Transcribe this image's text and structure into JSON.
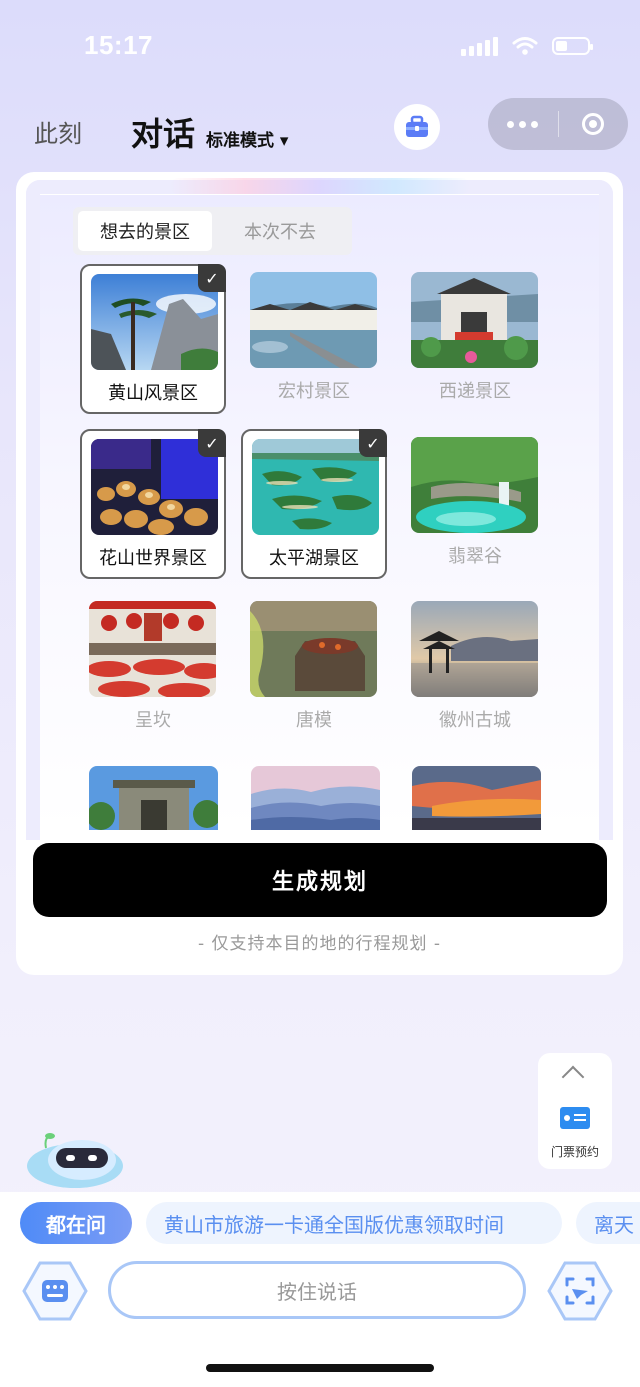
{
  "status": {
    "time": "15:17"
  },
  "header": {
    "tab_now": "此刻",
    "tab_chat": "对话",
    "mode": "标准模式",
    "mode_caret": "▾"
  },
  "segment": {
    "want": "想去的景区",
    "skip": "本次不去"
  },
  "spots": [
    {
      "name": "黄山风景区",
      "selected": true
    },
    {
      "name": "宏村景区",
      "selected": false
    },
    {
      "name": "西递景区",
      "selected": false
    },
    {
      "name": "花山世界景区",
      "selected": true
    },
    {
      "name": "太平湖景区",
      "selected": true
    },
    {
      "name": "翡翠谷",
      "selected": false
    },
    {
      "name": "呈坎",
      "selected": false
    },
    {
      "name": "唐模",
      "selected": false
    },
    {
      "name": "徽州古城",
      "selected": false
    }
  ],
  "check_mark": "✓",
  "generate_button": "生成规划",
  "note": "- 仅支持本目的地的行程规划 -",
  "ticket": {
    "label": "门票预约"
  },
  "ask": {
    "badge": "都在问",
    "chips": [
      "黄山市旅游一卡通全国版优惠领取时间",
      "离天"
    ]
  },
  "input": {
    "placeholder": "按住说话"
  },
  "colors": {
    "accent_blue": "#4f8bf7",
    "chip_text": "#5a8ff0",
    "button": "#000000"
  }
}
